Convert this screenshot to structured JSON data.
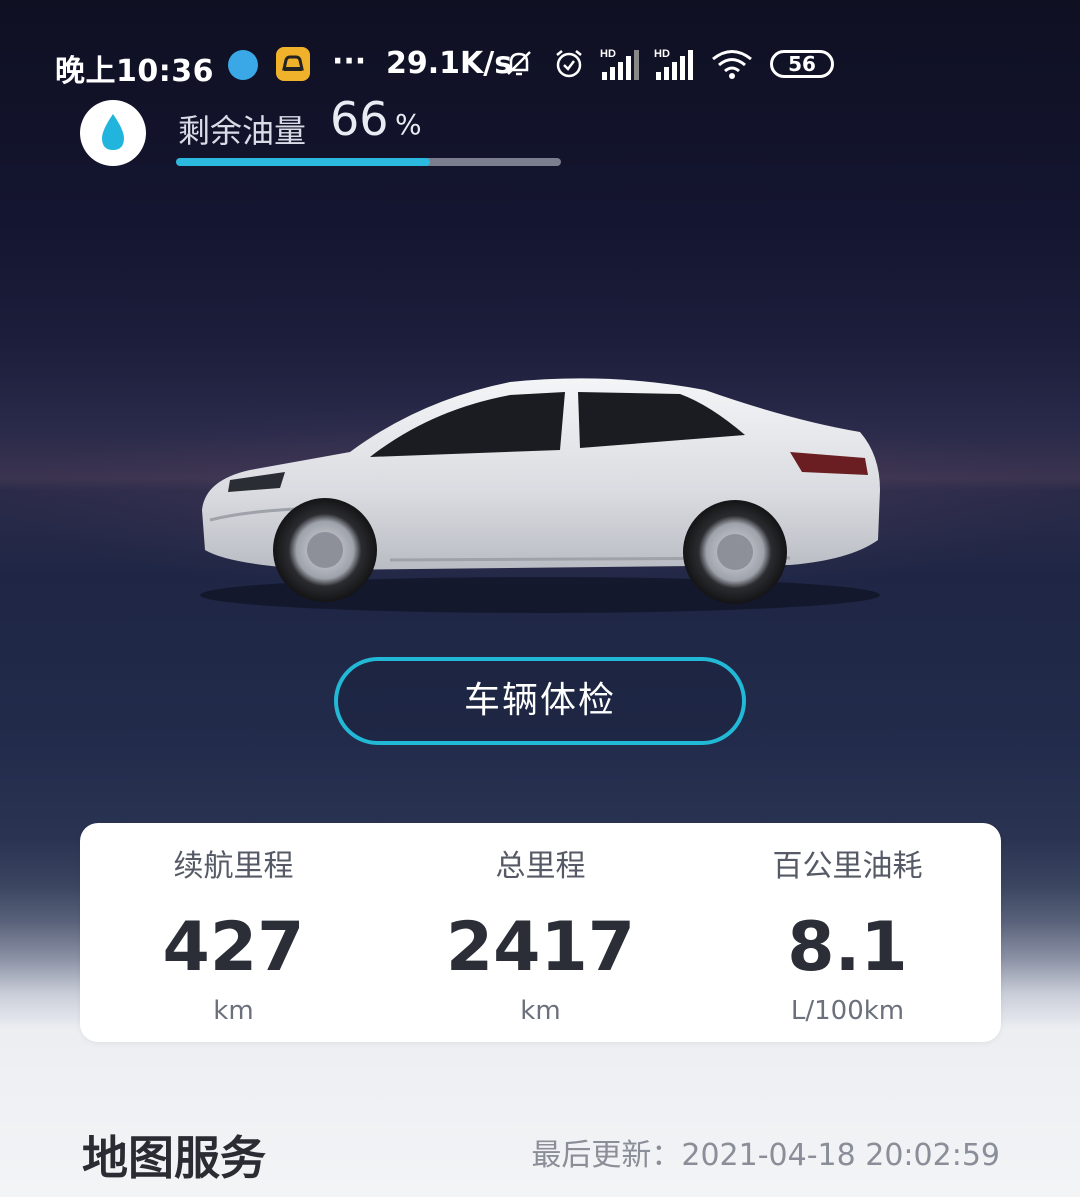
{
  "status_bar": {
    "time": "晚上10:36",
    "dots": "···",
    "net_speed": "29.1K/s",
    "battery": "56",
    "icons": [
      "browser-icon",
      "car-app-icon",
      "mute-bell-icon",
      "alarm-icon",
      "hd-signal-icon",
      "hd-signal-icon",
      "wifi-icon"
    ]
  },
  "fuel": {
    "label": "剩余油量",
    "value": "66",
    "unit": "%",
    "level_percent": 66,
    "accent_color": "#2bb9e0"
  },
  "check_button": {
    "label": "车辆体检"
  },
  "stats": [
    {
      "label": "续航里程",
      "value": "427",
      "unit": "km"
    },
    {
      "label": "总里程",
      "value": "2417",
      "unit": "km"
    },
    {
      "label": "百公里油耗",
      "value": "8.1",
      "unit": "L/100km"
    }
  ],
  "map": {
    "title": "地图服务",
    "updated": "最后更新：2021-04-18 20:02:59"
  }
}
